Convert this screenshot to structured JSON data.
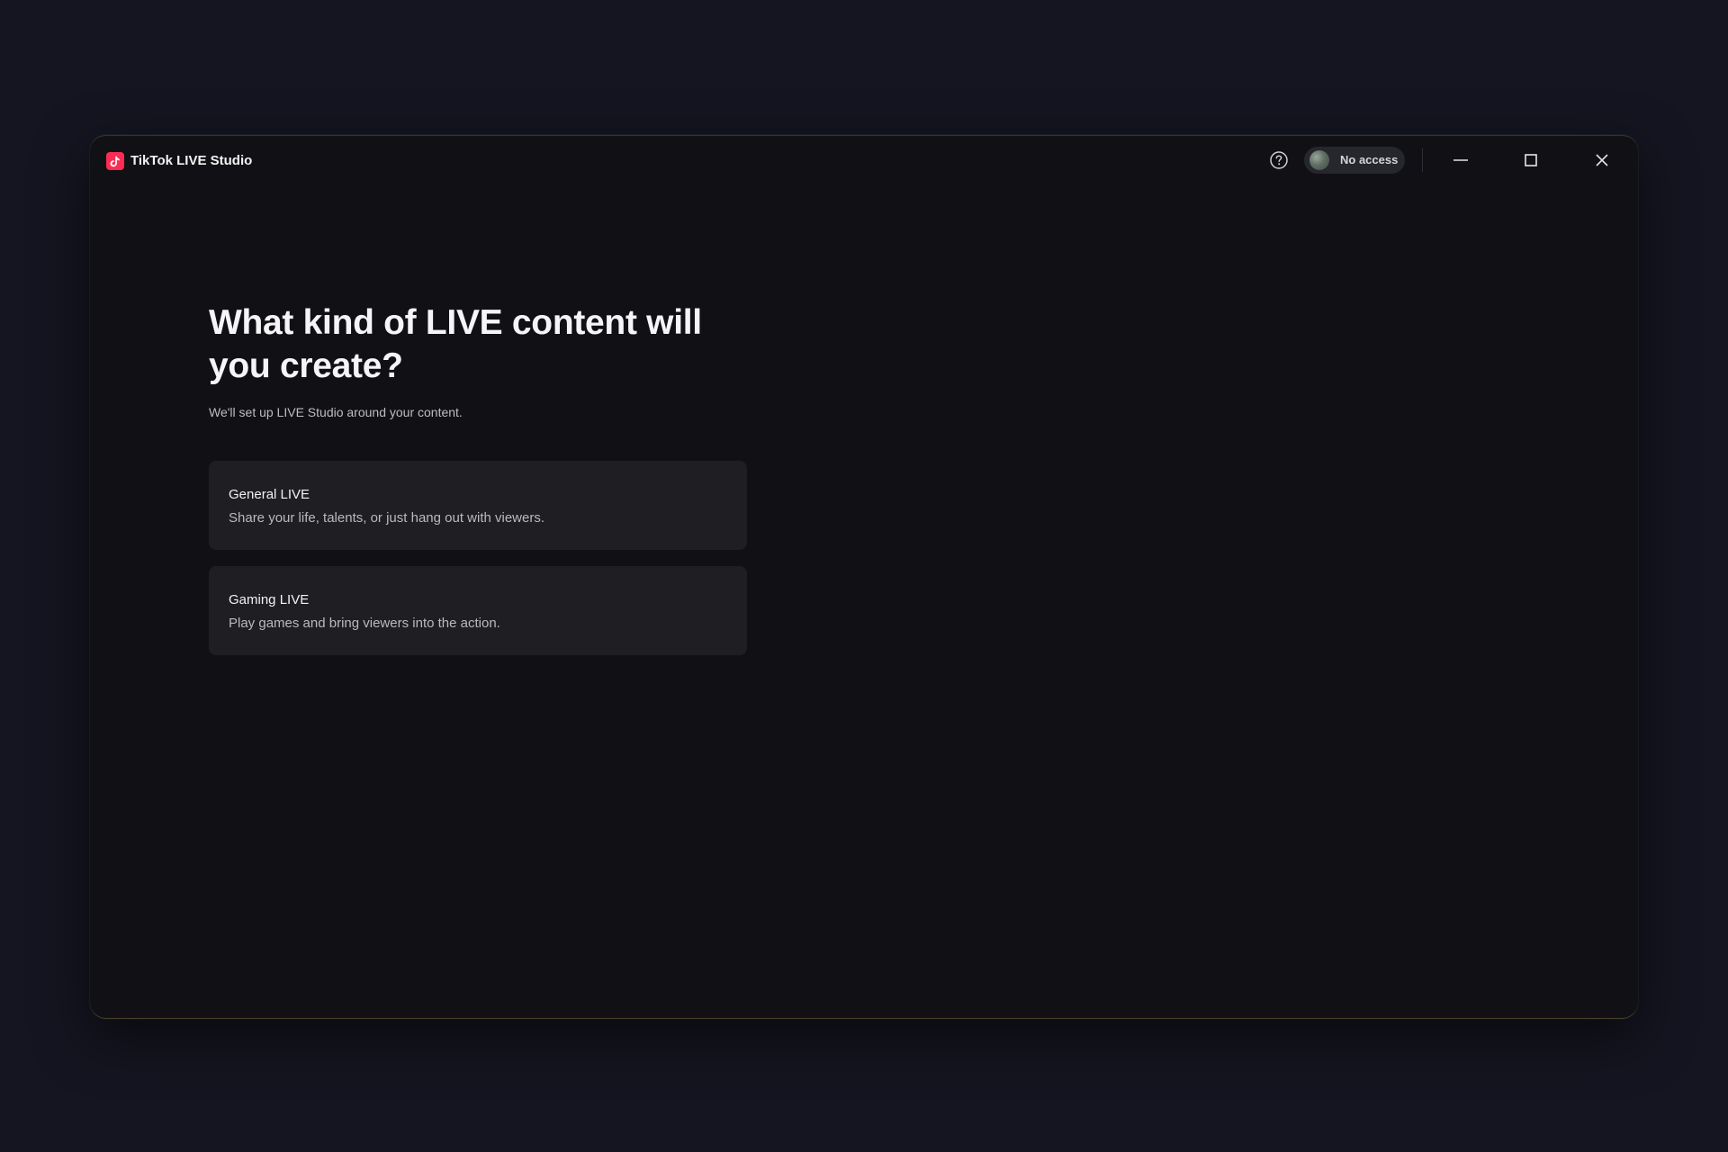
{
  "window": {
    "app_title": "TikTok LIVE Studio",
    "account_label": "No access",
    "icons": {
      "logo": "tiktok-logo-icon",
      "help": "help-circle-icon",
      "minimize": "minimize-icon",
      "maximize": "maximize-icon",
      "close": "close-icon"
    }
  },
  "main": {
    "title": "What kind of LIVE content will you create?",
    "subtitle": "We'll set up LIVE Studio around your content.",
    "options": [
      {
        "title": "General LIVE",
        "description": "Share your life, talents, or just hang out with viewers."
      },
      {
        "title": "Gaming LIVE",
        "description": "Play games and bring viewers into the action."
      }
    ]
  },
  "colors": {
    "page_background": "#141520",
    "window_background": "#111115",
    "card_background": "#1f1f23",
    "brand": "#fe2c55"
  }
}
